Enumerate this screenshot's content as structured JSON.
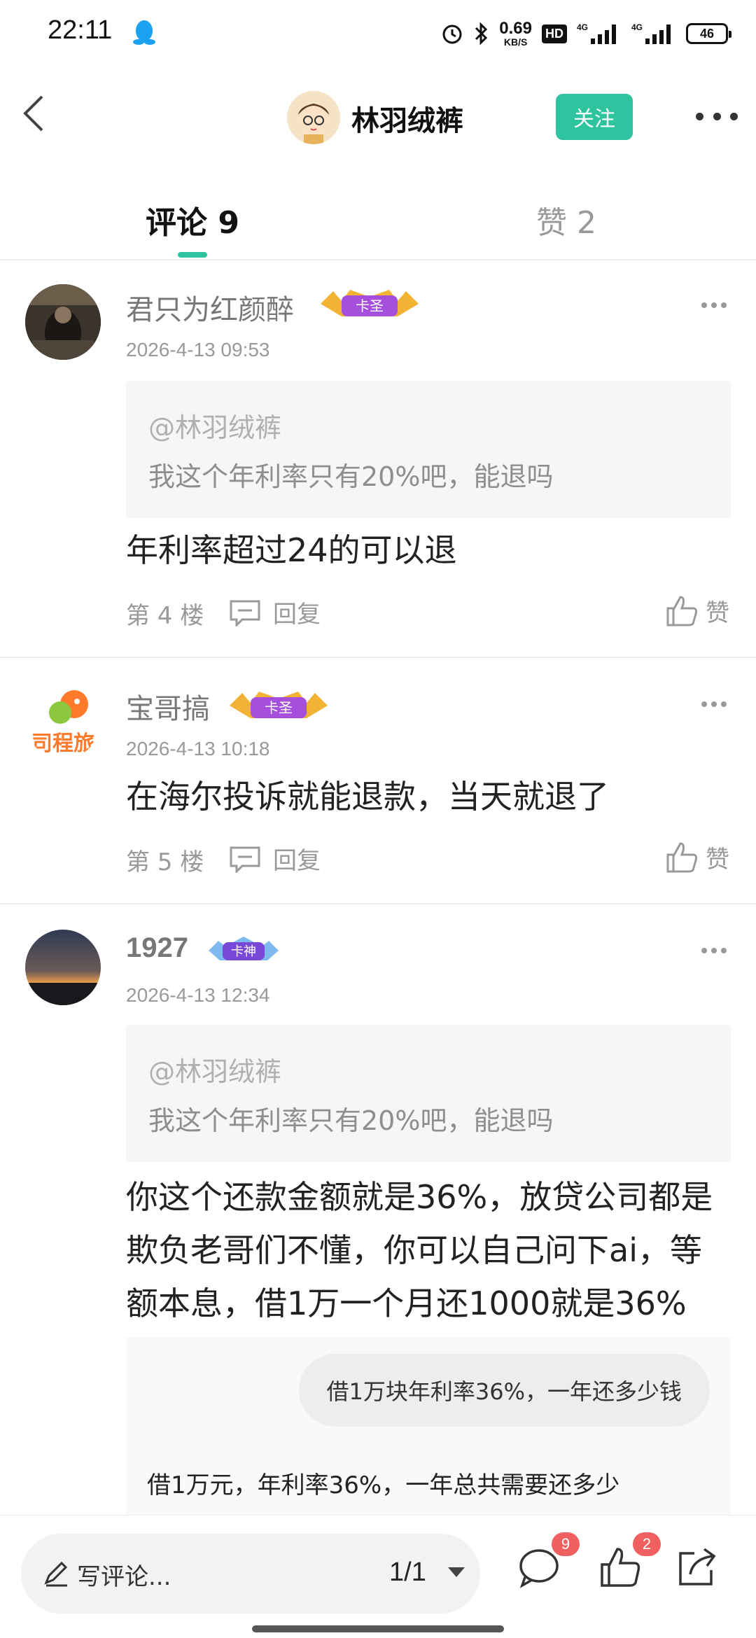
{
  "status_bar": {
    "time": "22:11",
    "net_speed_value": "0.69",
    "net_speed_unit": "KB/S",
    "hd_label": "HD",
    "net1": "4G",
    "net2": "4G",
    "battery": "46",
    "icons": [
      "qq-icon",
      "alarm-icon",
      "bluetooth-icon",
      "signal-icon",
      "battery-icon"
    ]
  },
  "header": {
    "title": "林羽绒裤",
    "follow_label": "关注",
    "accent_color": "#2ec4a0"
  },
  "tabs": {
    "comments": "评论 9",
    "likes": "赞 2"
  },
  "comments": [
    {
      "user": "君只为红颜醉",
      "badge": "卡圣",
      "time": "2026-4-13 09:53",
      "quote_mention": "@林羽绒裤",
      "quote_text": "我这个年利率只有20%吧，能退吗",
      "text": "年利率超过24的可以退",
      "floor": "第 4 楼",
      "reply": "回复",
      "like": "赞"
    },
    {
      "user": "宝哥搞",
      "badge": "卡圣",
      "avatar_text": "司程旅",
      "time": "2026-4-13 10:18",
      "text": "在海尔投诉就能退款，当天就退了",
      "floor": "第 5 楼",
      "reply": "回复",
      "like": "赞"
    },
    {
      "user": "1927",
      "badge": "卡神",
      "time": "2026-4-13 12:34",
      "quote_mention": "@林羽绒裤",
      "quote_text": "我这个年利率只有20%吧，能退吗",
      "text_lines": [
        "你这个还款金额就是36%，放贷公司都是",
        "欺负老哥们不懂，你可以自己问下ai，等",
        "额本息，借1万一个月还1000就是36%"
      ],
      "ai_question": "借1万块年利率36%，一年还多少钱",
      "ai_answer": "借1万元，年利率36%，一年总共需要还多少"
    }
  ],
  "bottom_bar": {
    "write_label": "写评论...",
    "page": "1/1",
    "comment_count": "9",
    "like_count": "2"
  }
}
